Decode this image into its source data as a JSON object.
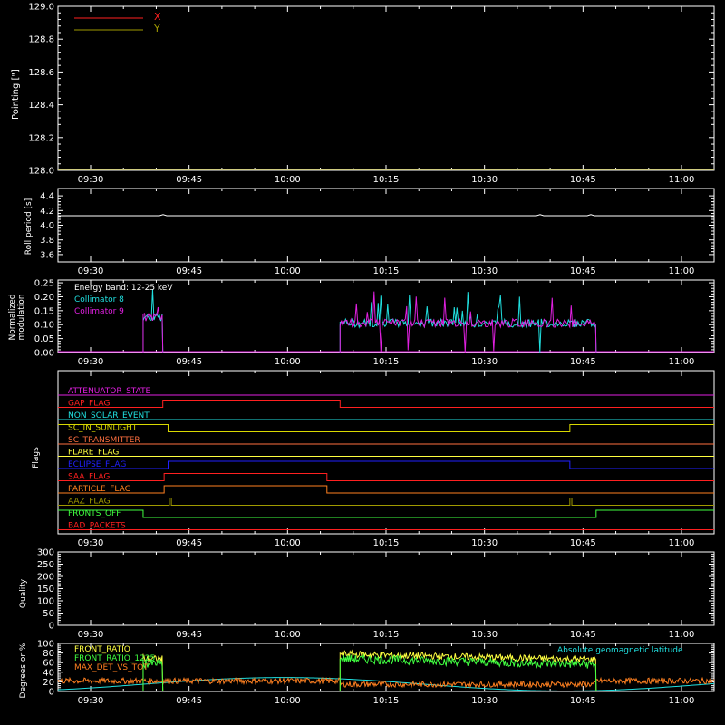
{
  "colors": {
    "bg": "#000000",
    "axes": "#ffffff",
    "red": "#ff2020",
    "yellow": "#d8d800",
    "olive": "#a09a00",
    "cyan": "#20e0e0",
    "magenta": "#e020e0",
    "orange": "#ff8020",
    "green": "#40ff40",
    "blue": "#2020ff",
    "darkorange": "#ff7040",
    "brightyellow": "#ffff40"
  },
  "time_ticks": [
    "09:30",
    "09:45",
    "10:00",
    "10:15",
    "10:30",
    "10:45",
    "11:00"
  ],
  "chart_data": [
    {
      "type": "line",
      "id": "pointing",
      "ylabel": "Pointing [\"]",
      "ylim": [
        128.0,
        129.0
      ],
      "yticks": [
        "128.0",
        "128.2",
        "128.4",
        "128.6",
        "128.8",
        "129.0"
      ],
      "legend": "top-left",
      "series": [
        {
          "name": "X",
          "color": "red",
          "values": []
        },
        {
          "name": "Y",
          "color": "olive",
          "values": []
        }
      ]
    },
    {
      "type": "line",
      "id": "roll",
      "ylabel": "Roll period [s]",
      "ylim": [
        3.5,
        4.5
      ],
      "yticks": [
        "3.6",
        "3.8",
        "4.0",
        "4.2",
        "4.4"
      ],
      "series": [
        {
          "name": "",
          "color": "axes",
          "x": [
            "09:25",
            "11:08"
          ],
          "values": [
            4.13,
            4.13
          ]
        }
      ]
    },
    {
      "type": "line",
      "id": "modulation",
      "ylabel": "Normalized modulation",
      "ylabel_lines": [
        "Normalized",
        "modulation"
      ],
      "ylim": [
        0,
        0.26
      ],
      "yticks": [
        "0.00",
        "0.05",
        "0.10",
        "0.15",
        "0.20",
        "0.25"
      ],
      "annotations": [
        "Energy band: 12-25 keV"
      ],
      "legend": "top-left",
      "series": [
        {
          "name": "Collimator 8",
          "color": "cyan",
          "segments": [
            {
              "x": [
                "09:38",
                "09:41"
              ],
              "level": 0.12
            },
            {
              "x": [
                "10:08",
                "10:47"
              ],
              "level": 0.1
            }
          ]
        },
        {
          "name": "Collimator 9",
          "color": "magenta",
          "segments": [
            {
              "x": [
                "09:38",
                "09:41"
              ],
              "level": 0.12
            },
            {
              "x": [
                "10:08",
                "10:47"
              ],
              "level": 0.1
            }
          ]
        }
      ]
    },
    {
      "type": "line",
      "id": "flags",
      "ylabel": "Flags",
      "series": [
        {
          "name": "ATTENUATOR_STATE",
          "color": "magenta",
          "steps": []
        },
        {
          "name": "GAP_FLAG",
          "color": "red",
          "steps": [
            [
              "09:41",
              "10:08"
            ]
          ]
        },
        {
          "name": "NON_SOLAR_EVENT",
          "color": "cyan",
          "steps": []
        },
        {
          "name": "SC_IN_SUNLIGHT",
          "color": "yellow",
          "steps": [
            [
              "09:41.8",
              "10:43"
            ]
          ],
          "invert": true
        },
        {
          "name": "SC_TRANSMITTER",
          "color": "darkorange",
          "steps": []
        },
        {
          "name": "FLARE_FLAG",
          "color": "brightyellow",
          "steps": []
        },
        {
          "name": "ECLIPSE_FLAG",
          "color": "blue",
          "steps": [
            [
              "09:41.8",
              "10:43"
            ]
          ]
        },
        {
          "name": "SAA_FLAG",
          "color": "red",
          "steps": [
            [
              "09:41.2",
              "10:06"
            ]
          ]
        },
        {
          "name": "PARTICLE_FLAG",
          "color": "orange",
          "steps": [
            [
              "09:41.2",
              "10:06"
            ]
          ]
        },
        {
          "name": "AAZ_FLAG",
          "color": "olive",
          "steps": [
            [
              "09:42",
              "09:42.3"
            ],
            [
              "10:43",
              "10:43.3"
            ]
          ]
        },
        {
          "name": "FRONTS_OFF",
          "color": "green",
          "steps": [
            [
              "09:38",
              "10:47"
            ]
          ],
          "invert": true
        },
        {
          "name": "BAD_PACKETS",
          "color": "red",
          "steps": []
        }
      ]
    },
    {
      "type": "line",
      "id": "quality",
      "ylabel": "Quality",
      "ylim": [
        0,
        300
      ],
      "yticks": [
        "0",
        "50",
        "100",
        "150",
        "200",
        "250",
        "300"
      ],
      "series": []
    },
    {
      "type": "line",
      "id": "ratios",
      "ylabel": "Degrees or %",
      "ylim": [
        0,
        100
      ],
      "yticks": [
        "0",
        "20",
        "40",
        "60",
        "80",
        "100"
      ],
      "legend": "top-left",
      "annotations": [
        "Absolute geomagnetic latitude"
      ],
      "series": [
        {
          "name": "FRONT_RATIO",
          "color": "brightyellow"
        },
        {
          "name": "FRONT_RATIO_1225",
          "color": "green"
        },
        {
          "name": "MAX_DET_VS_TOT",
          "color": "orange"
        },
        {
          "name": "Absolute geomagnetic latitude",
          "color": "cyan"
        }
      ]
    }
  ]
}
